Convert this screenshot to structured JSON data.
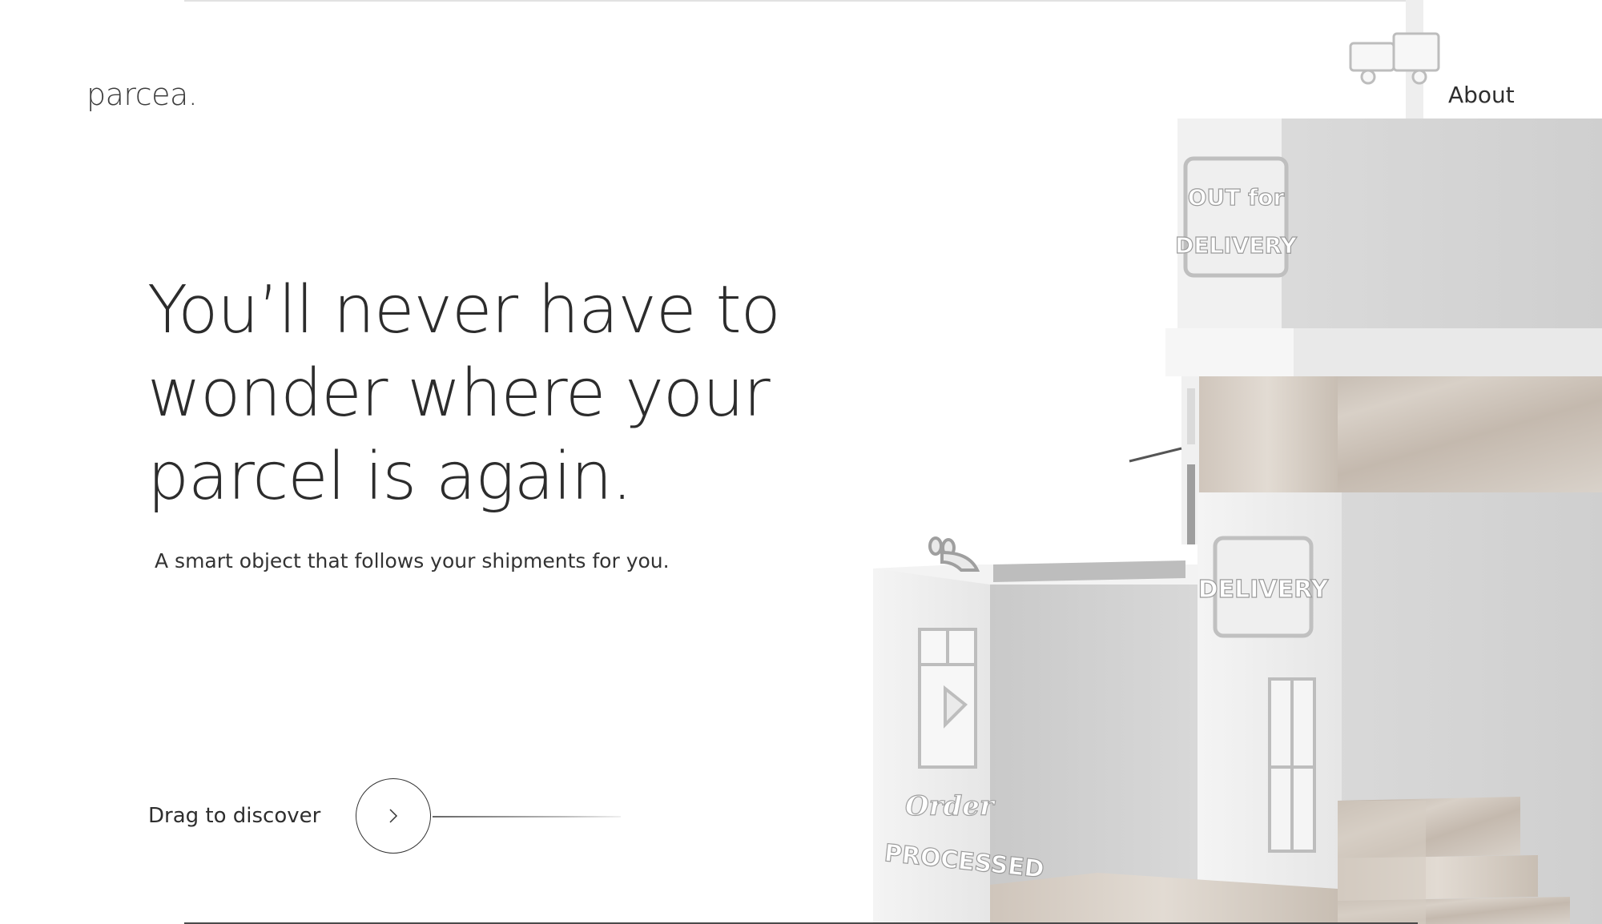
{
  "brand": {
    "logo": "parcea."
  },
  "nav": {
    "about_label": "About"
  },
  "hero": {
    "title_lines": [
      "You’ll never have to",
      "wonder where your",
      "parcel is again."
    ],
    "subtitle": "A smart object that follows your shipments for you."
  },
  "drag": {
    "label": "Drag to discover",
    "icon": "chevron-right-icon"
  },
  "illustration": {
    "signs": {
      "out_for": "OUT for",
      "delivery_top": "DELIVERY",
      "delivery_mid": "DELIVERY",
      "order": "Order",
      "processed": "PROCESSED"
    }
  },
  "colors": {
    "background": "#ffffff",
    "text": "#2c2c2c",
    "wood": "#c9bfb4",
    "building": "#dcdcdc"
  }
}
